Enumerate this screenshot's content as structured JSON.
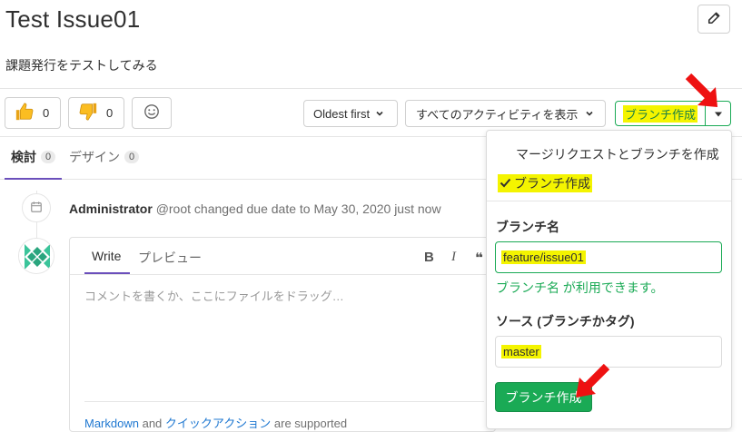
{
  "issue": {
    "title": "Test Issue01",
    "description": "課題発行をテストしてみる"
  },
  "awards": {
    "thumbs_up_count": "0",
    "thumbs_down_count": "0"
  },
  "controls": {
    "sort_label": "Oldest first",
    "activity_filter_label": "すべてのアクティビティを表示",
    "create_branch_label": "ブランチ作成"
  },
  "tabs": [
    {
      "label": "検討",
      "count": "0"
    },
    {
      "label": "デザイン",
      "count": "0"
    }
  ],
  "timeline": {
    "author": "Administrator",
    "system_note": "@root changed due date to May 30, 2020 just now"
  },
  "editor": {
    "write_tab": "Write",
    "preview_tab": "プレビュー",
    "placeholder": "コメントを書くか、ここにファイルをドラッグ…",
    "footer_markdown": "Markdown",
    "footer_and": "and",
    "footer_quick_actions": "クイックアクション",
    "footer_supported": "are supported"
  },
  "dropdown": {
    "option_mr_and_branch": "マージリクエストとブランチを作成",
    "option_branch": "ブランチ作成",
    "branch_name_label": "ブランチ名",
    "branch_name_value": "feature/issue01",
    "branch_available_msg": "ブランチ名 が利用できます。",
    "source_label": "ソース (ブランチかタグ)",
    "source_value": "master",
    "submit_label": "ブランチ作成"
  },
  "colors": {
    "accent_green": "#1aaa55",
    "highlight_yellow": "#f4f400",
    "tab_underline": "#6b4fbb",
    "annotation_arrow": "#ee1111"
  }
}
